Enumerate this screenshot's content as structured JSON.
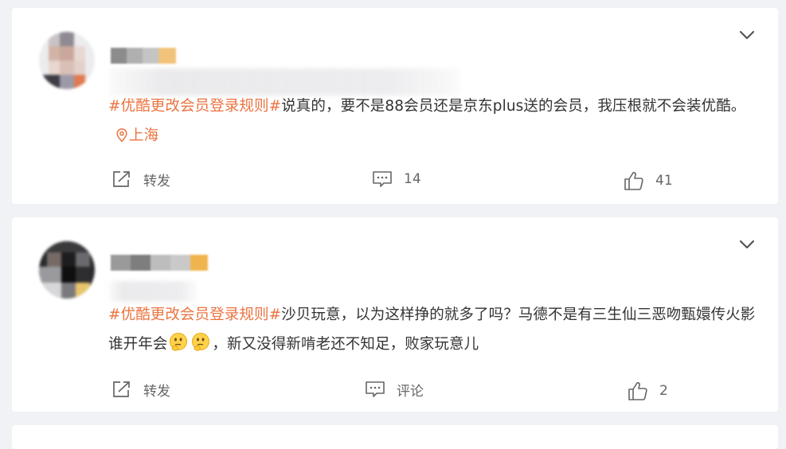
{
  "posts": [
    {
      "tag": "#优酷更改会员登录规则#",
      "text": "说真的，要不是88会员还是京东plus送的会员，我压根就不会装优酷。",
      "location": "上海",
      "actions": {
        "repost": "转发",
        "comment": "14",
        "like": "41"
      }
    },
    {
      "tag": "#优酷更改会员登录规则#",
      "text_before_emoji": "沙贝玩意，以为这样挣的就多了吗？马德不是有三生仙三恶吻甄嬛传火影谁开年会",
      "text_after_emoji": "，新又没得新啃老还不知足，败家玩意儿",
      "actions": {
        "repost": "转发",
        "comment": "评论",
        "like": "2"
      }
    }
  ],
  "icons": {
    "more": "chevron-down-icon",
    "location": "location-pin-icon",
    "repost": "share-icon",
    "comment": "comment-icon",
    "like": "thumbs-up-icon",
    "emoji": "thinking-face-emoji"
  },
  "colors": {
    "tag": "#eb7340",
    "text": "#333333",
    "muted": "#666666",
    "background": "#f1f2f5"
  }
}
